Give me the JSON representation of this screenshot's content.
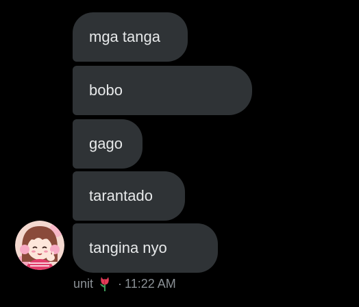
{
  "messages": [
    {
      "text": "mga tanga"
    },
    {
      "text": "bobo"
    },
    {
      "text": "gago"
    },
    {
      "text": "tarantado"
    },
    {
      "text": "tangina nyo"
    }
  ],
  "sender": {
    "name": "unit",
    "badge_icon": "tulip-icon",
    "separator": "·",
    "time": "11:22 AM",
    "avatar_icon": "anime-girl-avatar"
  },
  "colors": {
    "background": "#000000",
    "bubble": "#2f3336",
    "text": "#e7e9ea",
    "meta": "#8b9196"
  }
}
